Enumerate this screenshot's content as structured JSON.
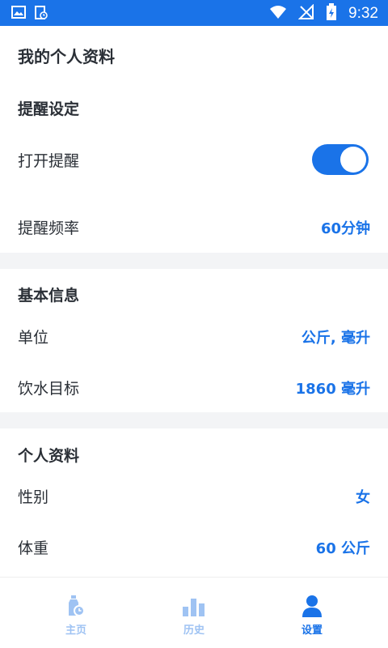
{
  "status_bar": {
    "time": "9:32"
  },
  "page_title": "我的个人资料",
  "reminder": {
    "section_title": "提醒设定",
    "toggle_label": "打开提醒",
    "toggle_on": true,
    "frequency_label": "提醒频率",
    "frequency_value": "60分钟"
  },
  "basic": {
    "section_title": "基本信息",
    "unit_label": "单位",
    "unit_value": "公斤, 毫升",
    "goal_label": "饮水目标",
    "goal_value": "1860 毫升"
  },
  "profile": {
    "section_title": "个人资料",
    "gender_label": "性别",
    "gender_value": "女",
    "weight_label": "体重",
    "weight_value": "60 公斤"
  },
  "tabs": [
    {
      "label": "主页",
      "icon": "bottle-clock-icon",
      "active": false
    },
    {
      "label": "历史",
      "icon": "bar-chart-icon",
      "active": false
    },
    {
      "label": "设置",
      "icon": "person-icon",
      "active": true
    }
  ],
  "colors": {
    "accent": "#1a73e8",
    "inactive_tab": "#9fc3f3",
    "text": "#2a2f36",
    "band": "#f3f4f6"
  }
}
